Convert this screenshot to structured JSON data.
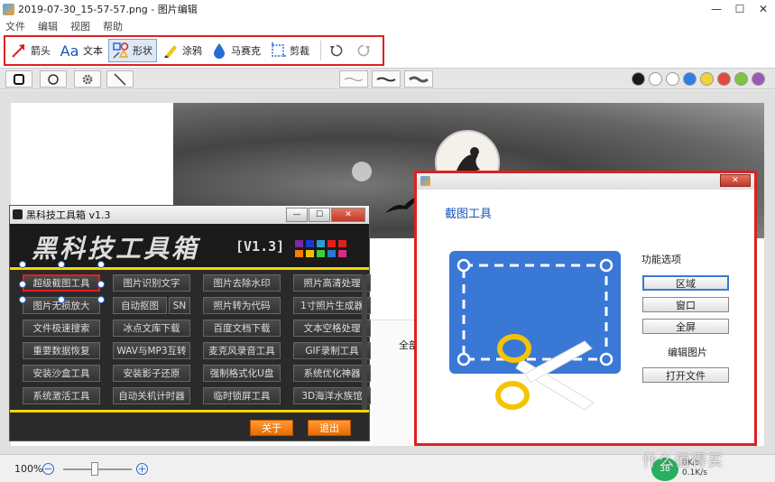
{
  "window": {
    "title": "2019-07-30_15-57-57.png - 图片编辑",
    "min": "—",
    "max": "☐",
    "close": "✕"
  },
  "menu": [
    "文件",
    "编辑",
    "视图",
    "帮助"
  ],
  "toolbar": {
    "tools": [
      {
        "label": "箭头",
        "icon": "arrow-icon"
      },
      {
        "label": "文本",
        "icon": "text-icon",
        "glyph": "Aa"
      },
      {
        "label": "形状",
        "icon": "shape-icon"
      },
      {
        "label": "涂鸦",
        "icon": "pen-icon"
      },
      {
        "label": "马赛克",
        "icon": "mosaic-icon"
      },
      {
        "label": "剪裁",
        "icon": "crop-icon"
      }
    ],
    "active": "形状",
    "highlight_color": "#e02020"
  },
  "palette": [
    "#1a1a1a",
    "#ffffff",
    "#ffffff",
    "#2f7fe0",
    "#f2d23a",
    "#e24a3b",
    "#7cc443",
    "#9b59b6",
    "#bdbdbd"
  ],
  "toolbox": {
    "title": "黑科技工具箱 v1.3",
    "banner": "黑科技工具箱",
    "version": "[V1.3]",
    "banner_colors": [
      "#7a2a9a",
      "#1a3ad0",
      "#2a9ad0",
      "#e0201a",
      "#e0201a",
      "#ff7a00",
      "#f0c000",
      "#3ad03a",
      "#2a7ad0",
      "#e02a8a"
    ],
    "buttons": [
      "超级截图工具",
      "图片识别文字",
      "图片去除水印",
      "照片高清处理",
      "图片无损放大",
      "自动抠图",
      "照片转为代码",
      "1寸照片生成器",
      "文件极速搜索",
      "冰点文库下载",
      "百度文档下载",
      "文本空格处理",
      "重要数据恢复",
      "WAV与MP3互转",
      "麦克风录音工具",
      "GIF录制工具",
      "安装沙盒工具",
      "安装影子还原",
      "强制格式化U盘",
      "系统优化神器",
      "系统激活工具",
      "自动关机计时器",
      "临时锁屏工具",
      "3D海洋水族馆"
    ],
    "sn": "SN",
    "about": "关于",
    "exit": "退出"
  },
  "capture_window": {
    "close": "✕",
    "heading": "截图工具",
    "options_label": "功能选项",
    "buttons": [
      "区域",
      "窗口",
      "全屏"
    ],
    "edit_label": "编辑图片",
    "open_file": "打开文件"
  },
  "web": {
    "tab": "全部"
  },
  "status": {
    "zoom": "100%",
    "minus": "−",
    "plus": "+",
    "speed": "38",
    "upload": "0K/s",
    "download": "0.1K/s"
  },
  "watermark": "什么值得买"
}
